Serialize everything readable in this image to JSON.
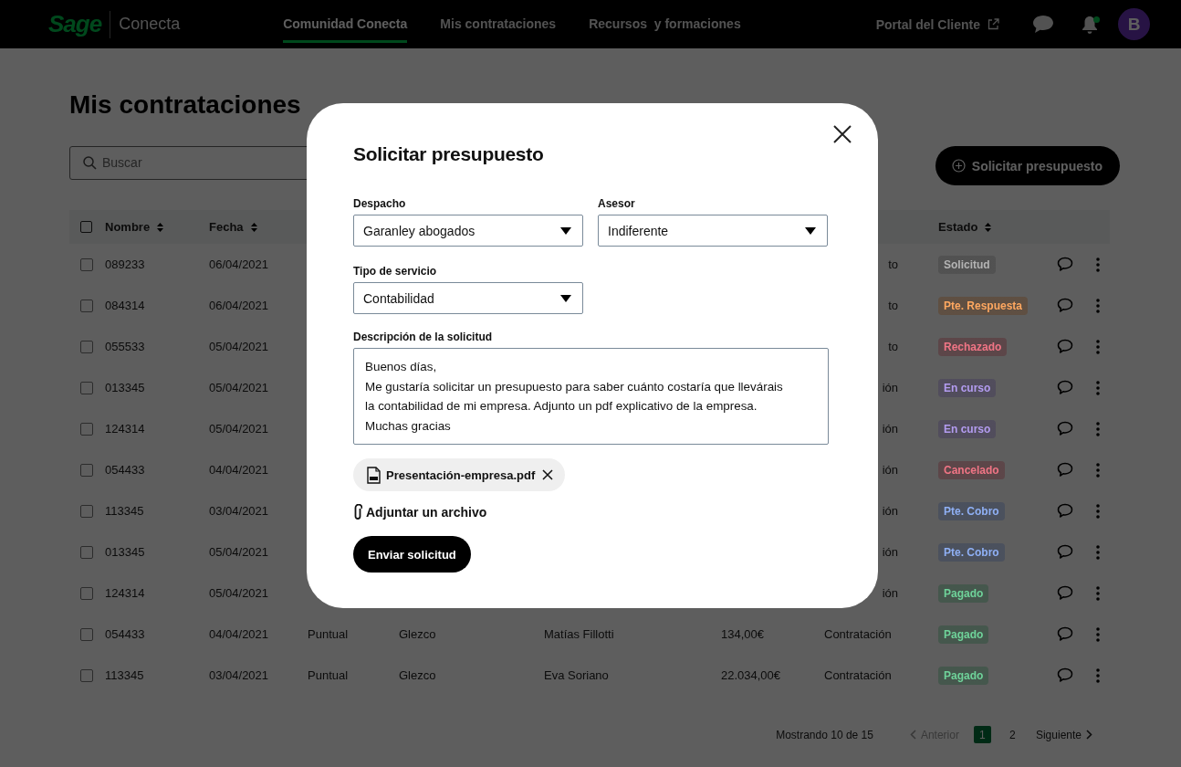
{
  "top_bar": {
    "logo": "Sage",
    "app_name": "Conecta",
    "nav": [
      {
        "label": "Comunidad Conecta",
        "selected": true
      },
      {
        "label": "Mis contrataciones",
        "selected": false
      },
      {
        "label": "Recursos  y formaciones",
        "selected": false
      }
    ],
    "portal_link": "Portal del Cliente",
    "notifications_unread": true,
    "avatar": "B"
  },
  "page": {
    "title": "Mis contrataciones",
    "search": {
      "placeholder": "Buscar"
    },
    "new_button": "Solicitar presupuesto"
  },
  "table": {
    "select_all": {
      "checked": false
    },
    "columns": [
      {
        "label": "Nombre"
      },
      {
        "label": "Fecha"
      },
      {
        "label": "Estado"
      }
    ],
    "rows": [
      {
        "checked": false,
        "nombre": "089233",
        "fecha": "06/04/2021",
        "column_7": "to",
        "estado": {
          "label": "Solicitud",
          "color": "#b4b4b4"
        }
      },
      {
        "checked": false,
        "nombre": "084314",
        "fecha": "06/04/2021",
        "column_7": "to",
        "estado": {
          "label": "Pte. Respuesta",
          "color": "#ffa860"
        }
      },
      {
        "checked": false,
        "nombre": "055533",
        "fecha": "05/04/2021",
        "column_7": "to",
        "estado": {
          "label": "Rechazado",
          "color": "#f07585"
        }
      },
      {
        "checked": false,
        "nombre": "013345",
        "fecha": "05/04/2021",
        "column_7": "ión",
        "estado": {
          "label": "En curso",
          "color": "#b39cf0"
        }
      },
      {
        "checked": false,
        "nombre": "124314",
        "fecha": "05/04/2021",
        "column_7": "ión",
        "estado": {
          "label": "En curso",
          "color": "#b39cf0"
        }
      },
      {
        "checked": false,
        "nombre": "054433",
        "fecha": "04/04/2021",
        "column_7": "ión",
        "estado": {
          "label": "Cancelado",
          "color": "#f07585"
        }
      },
      {
        "checked": false,
        "nombre": "113345",
        "fecha": "03/04/2021",
        "column_7": "ión",
        "estado": {
          "label": "Pte. Cobro",
          "color": "#8fb0f5"
        }
      },
      {
        "checked": false,
        "nombre": "013345",
        "fecha": "05/04/2021",
        "column_7": "ión",
        "estado": {
          "label": "Pte. Cobro",
          "color": "#8fb0f5"
        }
      },
      {
        "checked": false,
        "nombre": "124314",
        "fecha": "05/04/2021",
        "column_7": "ión",
        "estado": {
          "label": "Pagado",
          "color": "#6fd39a"
        }
      },
      {
        "checked": false,
        "nombre": "054433",
        "fecha": "04/04/2021",
        "column_3": "Puntual",
        "column_4": "Glezco",
        "column_5": "Matías Fillotti",
        "column_6": "134,00€",
        "column_7": "Contratación",
        "estado": {
          "label": "Pagado",
          "color": "#6fd39a"
        }
      },
      {
        "checked": false,
        "nombre": "113345",
        "fecha": "03/04/2021",
        "column_3": "Puntual",
        "column_4": "Glezco",
        "column_5": "Eva Soriano",
        "column_6": "22.034,00€",
        "column_7": "Contratación",
        "estado": {
          "label": "Pagado",
          "color": "#6fd39a"
        }
      }
    ]
  },
  "pagination": {
    "summary": "Mostrando 10 de 15",
    "previous": {
      "label": "Anterior",
      "disabled": true
    },
    "pages": [
      {
        "label": "1",
        "selected": true
      },
      {
        "label": "2",
        "selected": false
      }
    ],
    "next": {
      "label": "Siguiente",
      "disabled": false
    }
  },
  "modal": {
    "title": "Solicitar presupuesto",
    "fields": [
      {
        "label": "Despacho",
        "value": "Garanley abogados"
      },
      {
        "label": "Asesor",
        "value": "Indiferente"
      },
      {
        "label": "Tipo de servicio",
        "value": "Contabilidad"
      }
    ],
    "description": {
      "label": "Descripción de la solicitud",
      "value": "Buenos días,\nMe gustaría solicitar un presupuesto para saber cuánto costaría que llevárais\nla contabilidad de mi empresa. Adjunto un pdf explicativo de la empresa.\nMuchas gracias"
    },
    "attachment": "Presentación-empresa.pdf",
    "attach_link": "Adjuntar un archivo",
    "submit": "Enviar solicitud"
  }
}
